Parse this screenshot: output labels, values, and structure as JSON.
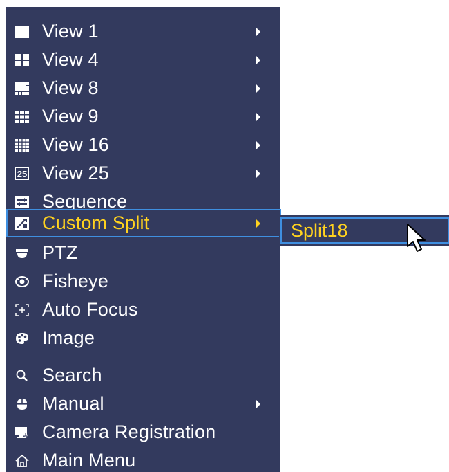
{
  "menu": {
    "items": [
      {
        "label": "View 1",
        "icon": "view1-icon",
        "has_submenu": true
      },
      {
        "label": "View 4",
        "icon": "view4-icon",
        "has_submenu": true
      },
      {
        "label": "View 8",
        "icon": "view8-icon",
        "has_submenu": true
      },
      {
        "label": "View 9",
        "icon": "view9-icon",
        "has_submenu": true
      },
      {
        "label": "View 16",
        "icon": "view16-icon",
        "has_submenu": true
      },
      {
        "label": "View 25",
        "icon": "view25-icon",
        "has_submenu": true
      },
      {
        "label": "Sequence",
        "icon": "sequence-icon",
        "has_submenu": false
      },
      {
        "label": "Custom Split",
        "icon": "custom-split-icon",
        "has_submenu": true,
        "active": true
      },
      {
        "label": "PTZ",
        "icon": "ptz-icon",
        "has_submenu": false
      },
      {
        "label": "Fisheye",
        "icon": "fisheye-icon",
        "has_submenu": false
      },
      {
        "label": "Auto Focus",
        "icon": "auto-focus-icon",
        "has_submenu": false
      },
      {
        "label": "Image",
        "icon": "palette-icon",
        "has_submenu": false
      },
      {
        "label": "Search",
        "icon": "search-icon",
        "has_submenu": false
      },
      {
        "label": "Manual",
        "icon": "manual-icon",
        "has_submenu": true
      },
      {
        "label": "Camera Registration",
        "icon": "camera-registration-icon",
        "has_submenu": false
      },
      {
        "label": "Main Menu",
        "icon": "home-icon",
        "has_submenu": false
      }
    ]
  },
  "submenu": {
    "items": [
      {
        "label": "Split18",
        "selected": true
      }
    ]
  },
  "icon_25_text": "25",
  "colors": {
    "menu_bg": "#333a5e",
    "text": "#ffffff",
    "highlight_text": "#ffd21f",
    "highlight_border": "#3f8fe0"
  }
}
